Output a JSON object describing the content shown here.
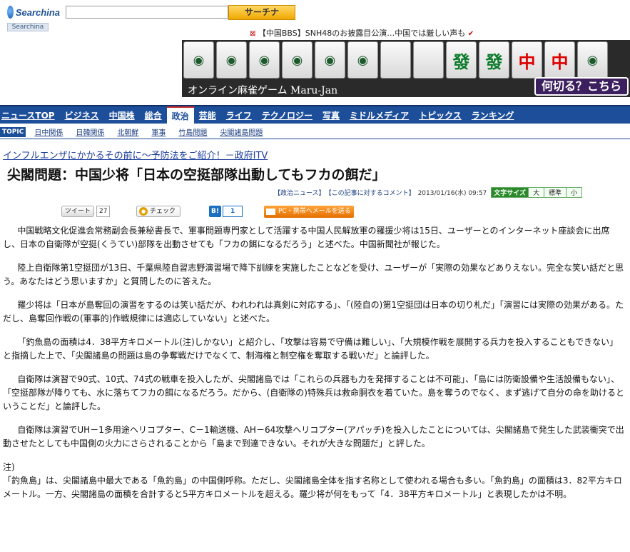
{
  "header": {
    "logo_text": "Searchina",
    "logo_tab": "Searchina",
    "search_value": "",
    "search_button": "サーチナ"
  },
  "ticker": {
    "icon": "⊠",
    "text": "【中国BBS】SNH48のお披露目公演…中国では厳しい声も",
    "arrow": "✔"
  },
  "ad": {
    "tiles": [
      "◉",
      "◉",
      "◉",
      "◉",
      "◉",
      "◉",
      "",
      "",
      "發",
      "發",
      "中",
      "中",
      "◉"
    ],
    "title": "オンライン麻雀ゲーム Maru-Jan",
    "cta": "何切る？こちら"
  },
  "nav": {
    "items": [
      "ニュースTOP",
      "ビジネス",
      "中国株",
      "総合",
      "政治",
      "芸能",
      "ライフ",
      "テクノロジー",
      "写真",
      "ミドルメディア",
      "トピックス",
      "ランキング"
    ],
    "active": "政治"
  },
  "topic": {
    "label": "TOPIC",
    "items": [
      "日中関係",
      "日韓関係",
      "北朝鮮",
      "軍事",
      "竹島問題",
      "尖閣諸島問題"
    ]
  },
  "promo": "インフルエンザにかかるその前に～予防法をご紹介！－政府ITV",
  "article": {
    "headline": "尖閣問題：中国少将「日本の空挺部隊出動してもフカの餌だ」",
    "category_link": "【政治ニュース】",
    "comment_link": "【この記事に対するコメント】",
    "date": "2013/01/16(水) 09:57",
    "size_label": "文字サイズ",
    "size_options": [
      "大",
      "標準",
      "小"
    ],
    "paragraphs": [
      "中国戦略文化促進会常務副会長兼秘書長で、軍事問題専門家として活躍する中国人民解放軍の羅援少将は15日、ユーザーとのインターネット座談会に出席し、日本の自衛隊が空挺(くうてい)部隊を出動させても「フカの餌になるだろう」と述べた。中国新聞社が報じた。",
      "陸上自衛隊第1空挺団が13日、千葉県陸自習志野演習場で降下訓練を実施したことなどを受け、ユーザーが「実際の効果などありえない。完全な笑い話だと思う。あなたはどう思いますか」と質問したのに答えた。",
      "羅少将は「日本が島奪回の演習をするのは笑い話だが、われわれは真剣に対応する」、「(陸自の)第1空挺団は日本の切り札だ」「演習には実際の効果がある。ただし、島奪回作戦の(軍事的)作戦規律には適応していない」と述べた。",
      "「釣魚島の面積は4．38平方キロメートル(注)しかない」と紹介し、「攻撃は容易で守備は難しい」、「大規模作戦を展開する兵力を投入することもできない」と指摘した上で、「尖閣諸島の問題は島の争奪戦だけでなくて、制海権と制空権を奪取する戦いだ」と論評した。",
      "自衛隊は演習で90式、10式、74式の戦車を投入したが、尖閣諸島では「これらの兵器も力を発揮することは不可能」、「島には防衛設備や生活設備もない」、「空挺部隊が降りても、水に落ちてフカの餌になるだろう。だから、(自衛隊の)特殊兵は救命胴衣を着ていた。島を奪うのでなく、まず逃げて自分の命を助けるということだ」と論評した。",
      "自衛隊は演習でUH－1多用途ヘリコプター、C－1輸送機、AH－64攻撃ヘリコプター(アパッチ)を投入したことについては、尖閣諸島で発生した武装衝突で出動させたとしても中国側の火力にさらされることから「島まで到達できない。それが大きな問題だ」と評した。"
    ],
    "note_label": "注)",
    "note_text": "「釣魚島」は、尖閣諸島中最大である「魚釣島」の中国側呼称。ただし、尖閣諸島全体を指す名称として使われる場合も多い。「魚釣島」の面積は3．82平方キロメートル。一方、尖閣諸島の面積を合計すると5平方キロメートルを超える。羅少将が何をもって「4．38平方キロメートル」と表現したかは不明。"
  },
  "social": {
    "tweet_label": "ツイート",
    "tweet_count": "27",
    "check_label": "チェック",
    "hatena_label": "B!",
    "hatena_count": "1",
    "mail_label": "PC・携帯へメールを送る"
  }
}
